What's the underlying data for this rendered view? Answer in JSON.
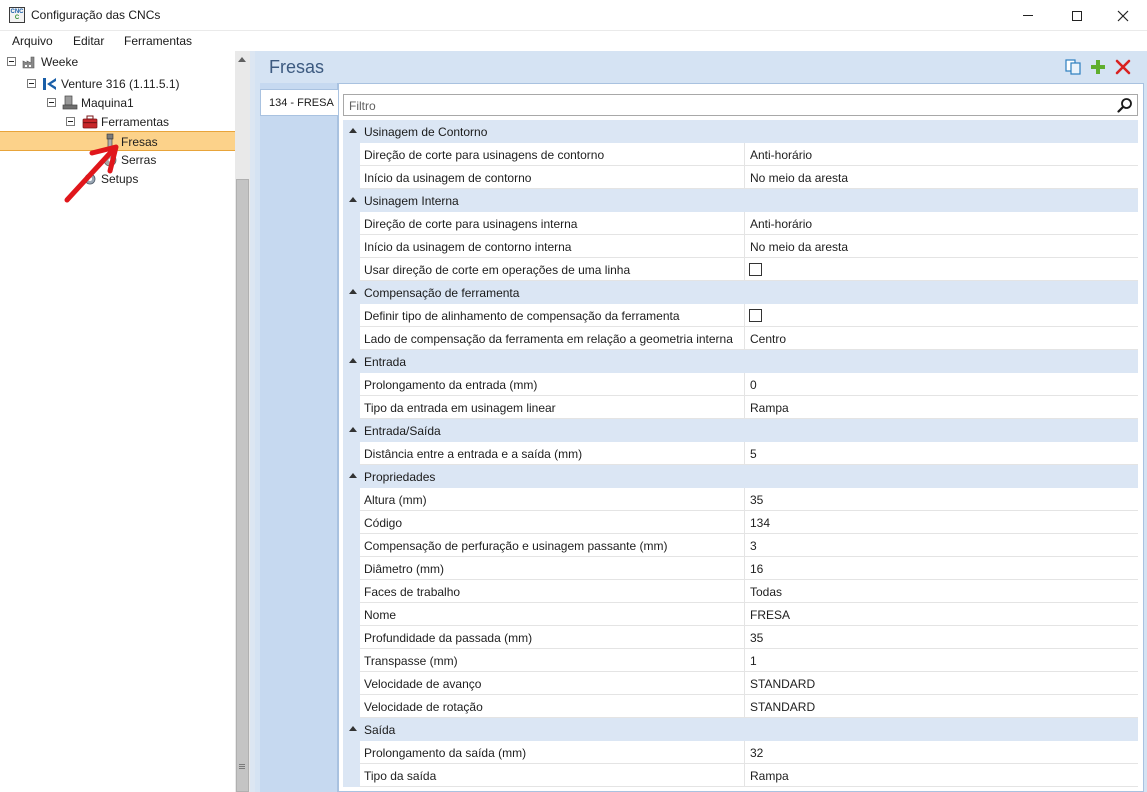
{
  "window": {
    "title": "Configuração das CNCs",
    "icon_label_top": "CNC",
    "icon_label_bottom": "C"
  },
  "menu": [
    "Arquivo",
    "Editar",
    "Ferramentas"
  ],
  "tree": {
    "nodes": [
      {
        "label": "Weeke",
        "icon": "factory-icon",
        "expanded": true
      },
      {
        "label": "Venture 316 (1.11.5.1)",
        "icon": "machine-brand-icon",
        "expanded": true
      },
      {
        "label": "Maquina1",
        "icon": "machine-icon",
        "expanded": true
      },
      {
        "label": "Ferramentas",
        "icon": "toolbox-icon",
        "expanded": true
      },
      {
        "label": "Fresas",
        "icon": "mill-tool-icon",
        "selected": true
      },
      {
        "label": "Serras",
        "icon": "saw-icon"
      },
      {
        "label": "Setups",
        "icon": "gear-icon"
      }
    ]
  },
  "main": {
    "title": "Fresas",
    "toolbar": {
      "copy": "copy-icon",
      "add": "add-icon",
      "delete": "delete-icon"
    },
    "tab": "134 - FRESA",
    "filter_placeholder": "Filtro",
    "categories": [
      {
        "label": "Usinagem de Contorno",
        "rows": [
          {
            "name": "Direção de corte para usinagens de contorno",
            "value": "Anti-horário"
          },
          {
            "name": "Início da usinagem de contorno",
            "value": "No meio da aresta"
          }
        ]
      },
      {
        "label": "Usinagem Interna",
        "rows": [
          {
            "name": "Direção de corte para usinagens interna",
            "value": "Anti-horário"
          },
          {
            "name": "Início da usinagem de contorno interna",
            "value": "No meio da aresta"
          },
          {
            "name": "Usar direção de corte em operações de uma linha",
            "checkbox": true
          }
        ]
      },
      {
        "label": "Compensação de ferramenta",
        "rows": [
          {
            "name": "Definir tipo de alinhamento de compensação da ferramenta",
            "checkbox": true
          },
          {
            "name": "Lado de compensação da ferramenta em relação a geometria interna",
            "value": "Centro"
          }
        ]
      },
      {
        "label": "Entrada",
        "rows": [
          {
            "name": "Prolongamento da entrada (mm)",
            "value": "0"
          },
          {
            "name": "Tipo da entrada em usinagem linear",
            "value": "Rampa"
          }
        ]
      },
      {
        "label": "Entrada/Saída",
        "rows": [
          {
            "name": "Distância entre a entrada e a saída (mm)",
            "value": "5"
          }
        ]
      },
      {
        "label": "Propriedades",
        "rows": [
          {
            "name": "Altura (mm)",
            "value": "35"
          },
          {
            "name": "Código",
            "value": "134"
          },
          {
            "name": "Compensação de perfuração e usinagem passante (mm)",
            "value": "3"
          },
          {
            "name": "Diâmetro (mm)",
            "value": "16"
          },
          {
            "name": "Faces de trabalho",
            "value": "Todas"
          },
          {
            "name": "Nome",
            "value": "FRESA"
          },
          {
            "name": "Profundidade da passada (mm)",
            "value": "35"
          },
          {
            "name": "Transpasse (mm)",
            "value": "1"
          },
          {
            "name": "Velocidade de avanço",
            "value": "STANDARD"
          },
          {
            "name": "Velocidade de rotação",
            "value": "STANDARD"
          }
        ]
      },
      {
        "label": "Saída",
        "rows": [
          {
            "name": "Prolongamento da saída (mm)",
            "value": "32"
          },
          {
            "name": "Tipo da saída",
            "value": "Rampa"
          }
        ]
      }
    ]
  },
  "colors": {
    "selection": "#fcd28a",
    "category_bg": "#dbe6f4",
    "panel_bg": "#d5e3f3",
    "title": "#3c5a80",
    "annotation_arrow": "#e0161b"
  }
}
